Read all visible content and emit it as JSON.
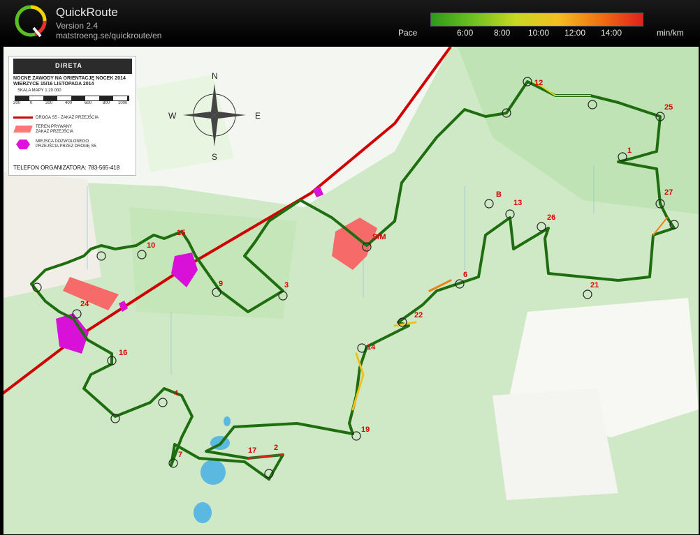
{
  "app": {
    "name": "QuickRoute",
    "version": "Version 2.4",
    "url": "matstroeng.se/quickroute/en"
  },
  "pace_legend": {
    "label": "Pace",
    "ticks": [
      "6:00",
      "8:00",
      "10:00",
      "12:00",
      "14:00"
    ],
    "unit": "min/km",
    "colors": [
      "#2e9a1a",
      "#70c020",
      "#c8d820",
      "#f0c020",
      "#f07010",
      "#e02020"
    ]
  },
  "map": {
    "legend": {
      "club": "DIRETA",
      "title_line1": "NOCNE ZAWODY NA ORIENTACJĘ NOCEK 2014",
      "title_line2": "WIERZYCE 15/16 LISTOPADA 2014",
      "scale_label": "SKALA MAPY 1:20 000",
      "scale_numbers": [
        "200",
        "0",
        "200",
        "400",
        "600",
        "800",
        "1000"
      ],
      "items": [
        {
          "symbol": "red-line",
          "text_1": "DROGA S5 - ZAKAZ PRZEJŚCIA",
          "text_2": ""
        },
        {
          "symbol": "red-area",
          "text_1": "TEREN PRYWANY",
          "text_2": "ZAKAZ PRZEJŚCIA"
        },
        {
          "symbol": "magenta-crossing",
          "text_1": "MIEJSCA DOZWOLONEGO",
          "text_2": "PRZEJŚCIA PRZEZ DROGĘ S5"
        }
      ],
      "phone": "TELEFON ORGANIZATORA: 783-565-418"
    },
    "compass": {
      "n": "N",
      "e": "E",
      "s": "S",
      "w": "W"
    },
    "start_finish": "S/M",
    "controls": [
      "1",
      "2",
      "3",
      "4",
      "6",
      "7",
      "9",
      "10",
      "12",
      "13",
      "14",
      "15",
      "16",
      "17",
      "19",
      "21",
      "22",
      "24",
      "25",
      "26",
      "27",
      "B"
    ]
  }
}
